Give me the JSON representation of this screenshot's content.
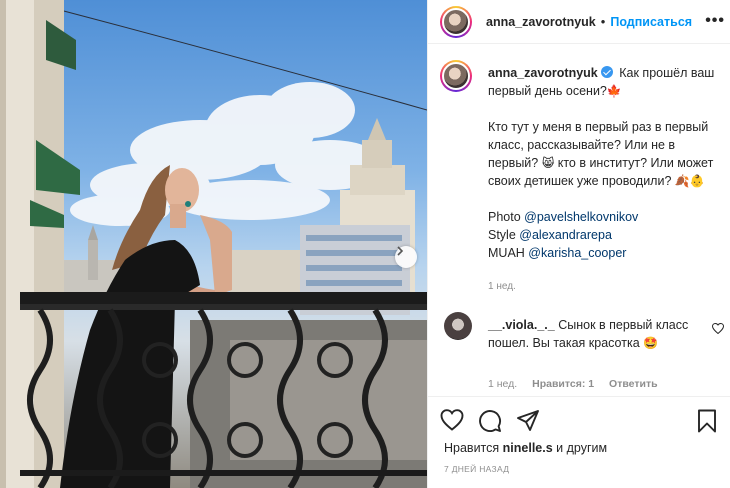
{
  "post": {
    "username": "anna_zavorotnyuk",
    "follow_label": "Подписаться",
    "more_label": "•••",
    "dot": "•"
  },
  "caption": {
    "username": "anna_zavorotnyuk",
    "line1": "Как прошёл ваш первый день осени?",
    "emoji1": "🍁",
    "line2a": "Кто тут у меня в первый раз в первый класс, рассказывайте? Или не в первый?",
    "emoji2": "😸",
    "line2b": "кто в институт? Или может своих детишек уже проводили?",
    "emoji3": "🍂👶",
    "photo_label": "Photo",
    "photo_mention": "@pavelshelkovnikov",
    "style_label": "Style",
    "style_mention": "@alexandrarepa",
    "muah_label": "MUAH",
    "muah_mention": "@karisha_cooper",
    "time": "1 нед."
  },
  "comment": {
    "username": "__.viola._._",
    "text": "Сынок в первый класс пошел. Вы такая красотка",
    "emoji": "🤩",
    "time": "1 нед.",
    "likes": "Нравится: 1",
    "reply_label": "Ответить"
  },
  "likes": {
    "prefix": "Нравится",
    "user": "ninelle.s",
    "suffix": "и другим"
  },
  "date": "7 ДНЕЙ НАЗАД",
  "colors": {
    "accent": "#0095f6",
    "verified": "#3897f0",
    "muted": "#8e8e8e",
    "mention": "#00376b"
  }
}
